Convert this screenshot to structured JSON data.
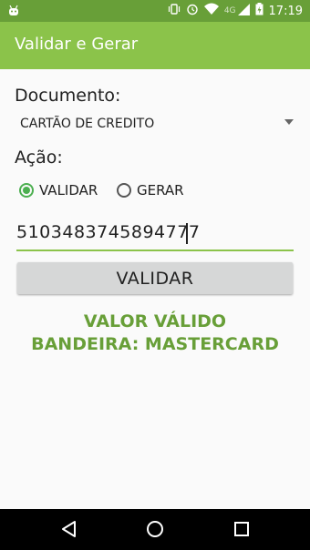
{
  "status_bar": {
    "time": "17:19",
    "network": "4G",
    "icons": [
      "android-icon",
      "vibrate-icon",
      "alarm-icon",
      "wifi-icon",
      "signal-icon",
      "battery-icon"
    ]
  },
  "app_bar": {
    "title": "Validar e Gerar"
  },
  "form": {
    "document_label": "Documento:",
    "document_selected": "CARTÃO DE CREDITO",
    "action_label": "Ação:",
    "radio_validar": "VALIDAR",
    "radio_gerar": "GERAR",
    "selected_action": "VALIDAR",
    "number_value": "5103483745894777",
    "button_label": "VALIDAR"
  },
  "result": {
    "line1": "VALOR VÁLIDO",
    "line2": "BANDEIRA: MASTERCARD",
    "color": "#689f38"
  },
  "colors": {
    "status_bar": "#689f38",
    "app_bar": "#8bc34a",
    "accent": "#4caf50"
  },
  "nav_bar": {
    "icons": [
      "back-icon",
      "home-icon",
      "recents-icon"
    ]
  }
}
